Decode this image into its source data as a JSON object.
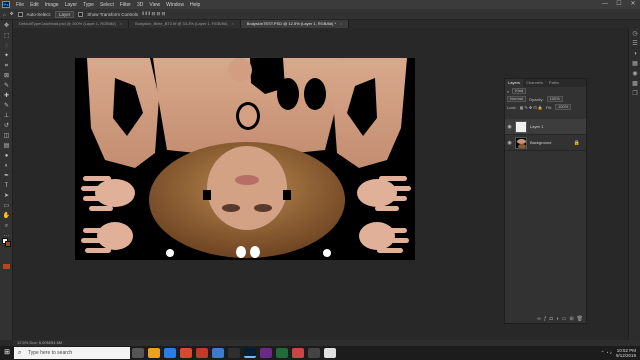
{
  "menubar": {
    "logo": "Ps",
    "items": [
      "File",
      "Edit",
      "Image",
      "Layer",
      "Type",
      "Select",
      "Filter",
      "3D",
      "View",
      "Window",
      "Help"
    ],
    "controls": [
      "—",
      "☐",
      "✕"
    ]
  },
  "options": {
    "auto_select_label": "Auto-Select:",
    "auto_select_value": "Layer",
    "transform_label": "Show Transform Controls"
  },
  "tabs": [
    {
      "label": "DefaultTypeCastHead.psd @ 100% (Layer 1, RGB/8#)",
      "active": false
    },
    {
      "label": "Bodyskin_Biele_BT2.tif @ 33.3% (Layer 1, RGB/8#)",
      "active": false
    },
    {
      "label": "BodyskinTEST.PSD @ 12.5% (Layer 1, RGB/8#) *",
      "active": true
    }
  ],
  "status": "12.5%   Doc: 6.00M/54.6M",
  "panel": {
    "tabs": [
      "Layers",
      "Channels",
      "Paths"
    ],
    "filter_label": "Kind",
    "blend_mode": "Normal",
    "opacity_label": "Opacity:",
    "opacity": "100%",
    "lock_label": "Lock:",
    "fill_label": "Fill:",
    "fill": "100%",
    "layers": [
      {
        "name": "Layer 1",
        "selected": true,
        "thumb": "white"
      },
      {
        "name": "Background",
        "selected": false,
        "thumb": "img",
        "locked": true
      }
    ],
    "footer_icons": [
      "link-icon",
      "fx-icon",
      "mask-icon",
      "adjustment-icon",
      "group-icon",
      "new-layer-icon",
      "trash-icon"
    ]
  },
  "taskbar": {
    "search_placeholder": "Type here to search",
    "time": "10:52 PM",
    "date": "9/12/2019"
  },
  "colors": {
    "skin": "#d6a487",
    "skin_shadow": "#b9836a",
    "hair": "#8a5a30",
    "hair_light": "#b8864e",
    "foreground": "#ffffff",
    "background": "#9a4a1a"
  }
}
